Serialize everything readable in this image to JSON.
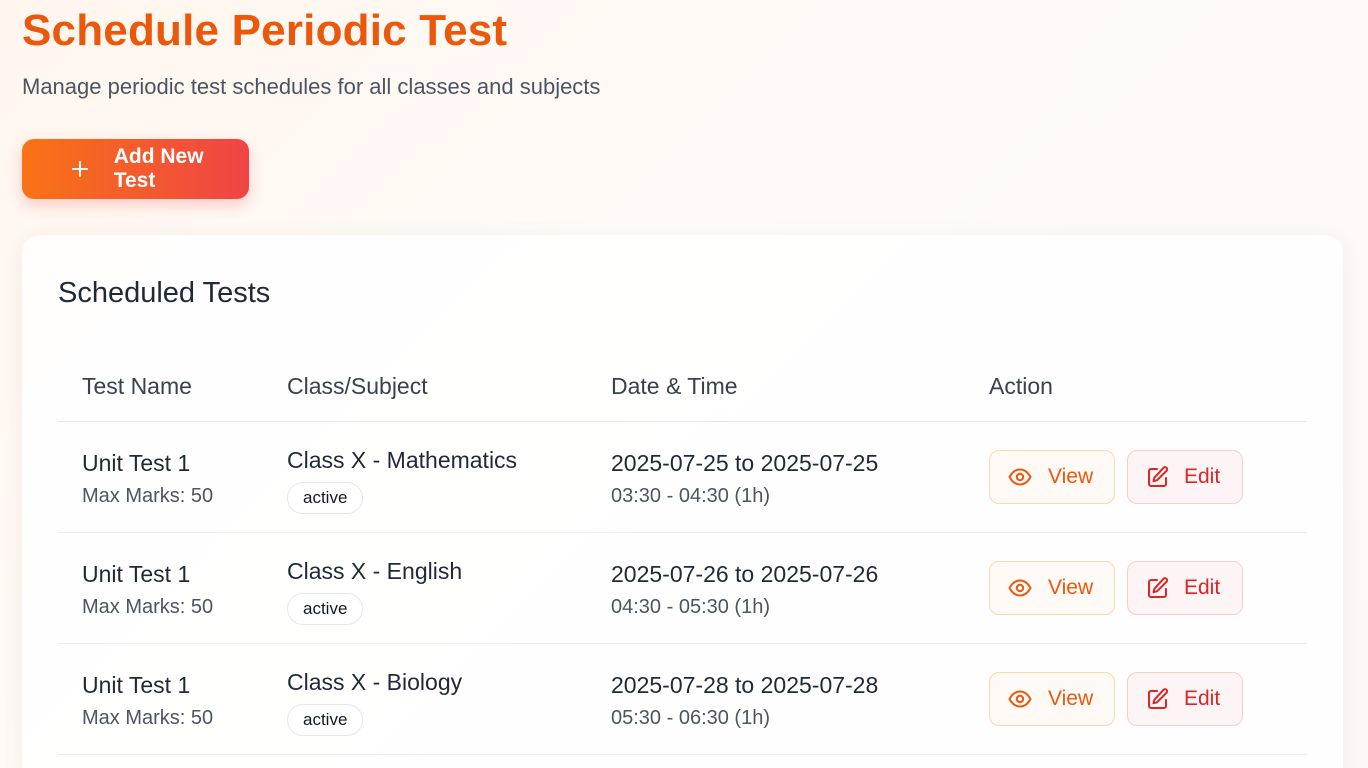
{
  "header": {
    "title": "Schedule Periodic Test",
    "subtitle": "Manage periodic test schedules for all classes and subjects",
    "add_button_label": "Add New Test"
  },
  "table_card": {
    "title": "Scheduled Tests",
    "columns": [
      "Test Name",
      "Class/Subject",
      "Date & Time",
      "Action"
    ],
    "rows": [
      {
        "test_name": "Unit Test 1",
        "max_marks": "Max Marks: 50",
        "class_subject": "Class X - Mathematics",
        "status": "active",
        "date_range": "2025-07-25 to 2025-07-25",
        "time_range": "03:30 - 04:30 (1h)",
        "view_label": "View",
        "edit_label": "Edit"
      },
      {
        "test_name": "Unit Test 1",
        "max_marks": "Max Marks: 50",
        "class_subject": "Class X - English",
        "status": "active",
        "date_range": "2025-07-26 to 2025-07-26",
        "time_range": "04:30 - 05:30 (1h)",
        "view_label": "View",
        "edit_label": "Edit"
      },
      {
        "test_name": "Unit Test 1",
        "max_marks": "Max Marks: 50",
        "class_subject": "Class X - Biology",
        "status": "active",
        "date_range": "2025-07-28 to 2025-07-28",
        "time_range": "05:30 - 06:30 (1h)",
        "view_label": "View",
        "edit_label": "Edit"
      }
    ]
  },
  "icons": {
    "add": "plus-icon",
    "view": "eye-icon",
    "edit": "edit-icon"
  },
  "colors": {
    "title": "#ea580c",
    "button_gradient_start": "#f97316",
    "button_gradient_end": "#ef4444",
    "view_accent": "#ea580c",
    "edit_accent": "#dc2626"
  }
}
